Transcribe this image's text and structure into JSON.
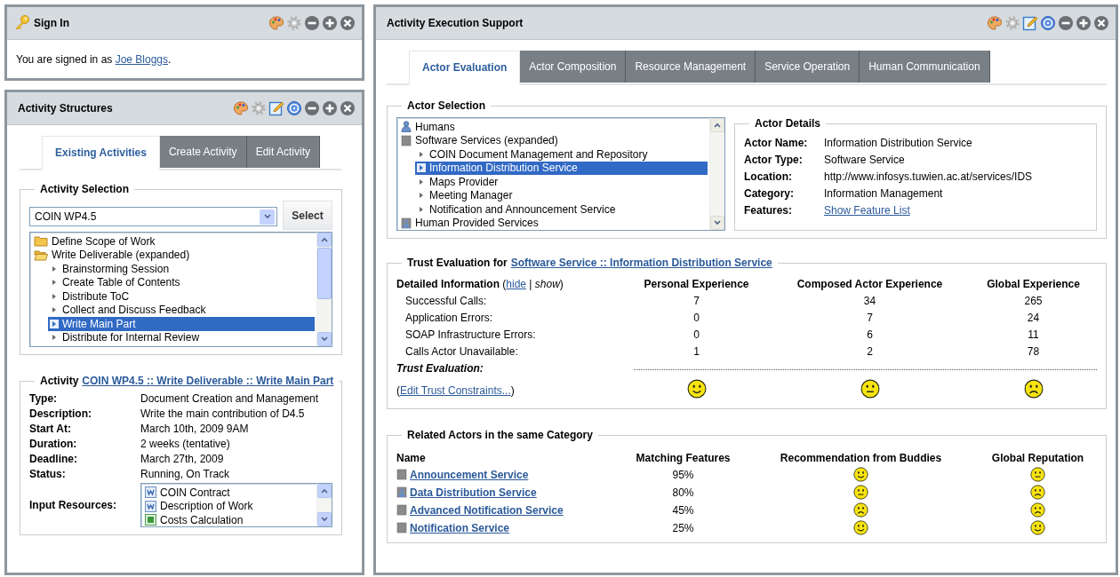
{
  "sign_in": {
    "title": "Sign In",
    "extended_tools": false,
    "text": "You are signed in as ",
    "user_link": "Joe Bloggs",
    "text_end": "."
  },
  "activity_structures": {
    "title": "Activity Structures",
    "extended_tools": true,
    "tabs": [
      {
        "label": "Existing Activities",
        "selected": true
      },
      {
        "label": "Create Activity",
        "selected": false
      },
      {
        "label": "Edit Activity",
        "selected": false
      }
    ],
    "activity_selection": {
      "legend": "Activity Selection",
      "dropdown_value": "COIN WP4.5",
      "button": "Select",
      "tree": [
        {
          "label": "Define Scope of Work",
          "kind": "folder",
          "selected": false
        },
        {
          "label": "Write Deliverable (expanded)",
          "kind": "folder",
          "selected": false,
          "children": [
            {
              "label": "Brainstorming Session",
              "kind": "task",
              "selected": false
            },
            {
              "label": "Create Table of Contents",
              "kind": "task",
              "selected": false
            },
            {
              "label": "Distribute ToC",
              "kind": "task",
              "selected": false
            },
            {
              "label": "Collect and Discuss Feedback",
              "kind": "task",
              "selected": false
            },
            {
              "label": "Write Main Part",
              "kind": "task",
              "selected": true
            },
            {
              "label": "Distribute for Internal Review",
              "kind": "task",
              "selected": false
            }
          ]
        }
      ]
    },
    "activity": {
      "legend": "Activity",
      "link": "COIN WP4.5 :: Write Deliverable :: Write Main Part",
      "fields": [
        {
          "label": "Type:",
          "value": "Document Creation and Management"
        },
        {
          "label": "Description:",
          "value": "Write the main contribution of D4.5"
        },
        {
          "label": "Start At:",
          "value": "March 10th, 2009 9AM"
        },
        {
          "label": "Duration:",
          "value": "2 weeks (tentative)"
        },
        {
          "label": "Deadline:",
          "value": "March 27th, 2009"
        },
        {
          "label": "Status:",
          "value": "Running, On Track"
        }
      ],
      "input_resources": {
        "label": "Input Resources:",
        "items": [
          {
            "label": "COIN Contract",
            "kind": "document"
          },
          {
            "label": "Description of Work",
            "kind": "document"
          },
          {
            "label": "Costs Calculation",
            "kind": "spreadsheet"
          }
        ]
      }
    }
  },
  "activity_execution": {
    "title": "Activity Execution Support",
    "extended_tools": true,
    "tabs": [
      {
        "label": "Actor Evaluation",
        "selected": true
      },
      {
        "label": "Actor Composition",
        "selected": false
      },
      {
        "label": "Resource Management",
        "selected": false
      },
      {
        "label": "Service Operation",
        "selected": false
      },
      {
        "label": "Human Communication",
        "selected": false
      }
    ],
    "actor_selection": {
      "legend": "Actor Selection",
      "tree": [
        {
          "label": "Humans",
          "kind": "human",
          "selected": false
        },
        {
          "label": "Software Services (expanded)",
          "kind": "software",
          "selected": false,
          "children": [
            {
              "label": "COIN Document Management and Repository",
              "kind": "task",
              "selected": false
            },
            {
              "label": "Information Distribution Service",
              "kind": "task",
              "selected": true
            },
            {
              "label": "Maps Provider",
              "kind": "task",
              "selected": false
            },
            {
              "label": "Meeting Manager",
              "kind": "task",
              "selected": false
            },
            {
              "label": "Notification and Announcement Service",
              "kind": "task",
              "selected": false
            }
          ]
        },
        {
          "label": "Human Provided Services",
          "kind": "human_service",
          "selected": false
        }
      ],
      "actor_details": {
        "legend": "Actor Details",
        "fields": [
          {
            "label": "Actor Name:",
            "value": "Information Distribution Service",
            "kind": "text"
          },
          {
            "label": "Actor Type:",
            "value": "Software Service",
            "kind": "text"
          },
          {
            "label": "Location:",
            "value": "http://www.infosys.tuwien.ac.at/services/IDS",
            "kind": "text"
          },
          {
            "label": "Category:",
            "value": "Information Management",
            "kind": "text"
          },
          {
            "label": "Features:",
            "value": "Show Feature List",
            "kind": "link"
          }
        ]
      }
    },
    "trust_evaluation": {
      "legend": "Trust Evaluation for",
      "link": "Software Service :: Information Distribution Service",
      "detail_prefix": "Detailed Information (",
      "hide_link": "hide",
      "detail_middle": " | ",
      "show_text": "show",
      "detail_suffix": ")",
      "columns": [
        "Personal Experience",
        "Composed Actor Experience",
        "Global Experience"
      ],
      "rows": [
        {
          "label": "Successful Calls:",
          "values": [
            "7",
            "34",
            "265"
          ]
        },
        {
          "label": "Application Errors:",
          "values": [
            "0",
            "7",
            "24"
          ]
        },
        {
          "label": "SOAP Infrastructure Errors:",
          "values": [
            "0",
            "6",
            "11"
          ]
        },
        {
          "label": "Calls Actor Unavailable:",
          "values": [
            "1",
            "2",
            "78"
          ]
        }
      ],
      "evaluation_label": "Trust Evaluation:",
      "edit_prefix": "(",
      "edit_link": "Edit Trust Constraints...",
      "edit_suffix": ")",
      "evaluations": [
        {
          "kind": "happy"
        },
        {
          "kind": "neutral"
        },
        {
          "kind": "sad"
        }
      ]
    },
    "related_actors": {
      "legend": "Related Actors in the same Category",
      "columns": [
        "Name",
        "Matching Features",
        "Recommendation from Buddies",
        "Global Reputation"
      ],
      "rows": [
        {
          "name": "Announcement Service",
          "kind": "software",
          "matching": "95%",
          "recommendation": {
            "kind": "happy"
          },
          "reputation": {
            "kind": "neutral"
          }
        },
        {
          "name": "Data Distribution Service",
          "kind": "human_service",
          "matching": "80%",
          "recommendation": {
            "kind": "neutral"
          },
          "reputation": {
            "kind": "sad"
          }
        },
        {
          "name": "Advanced Notification Service",
          "kind": "software",
          "matching": "45%",
          "recommendation": {
            "kind": "sad"
          },
          "reputation": {
            "kind": "sad"
          }
        },
        {
          "name": "Notification Service",
          "kind": "software",
          "matching": "25%",
          "recommendation": {
            "kind": "happy"
          },
          "reputation": {
            "kind": "happy"
          }
        }
      ]
    }
  }
}
